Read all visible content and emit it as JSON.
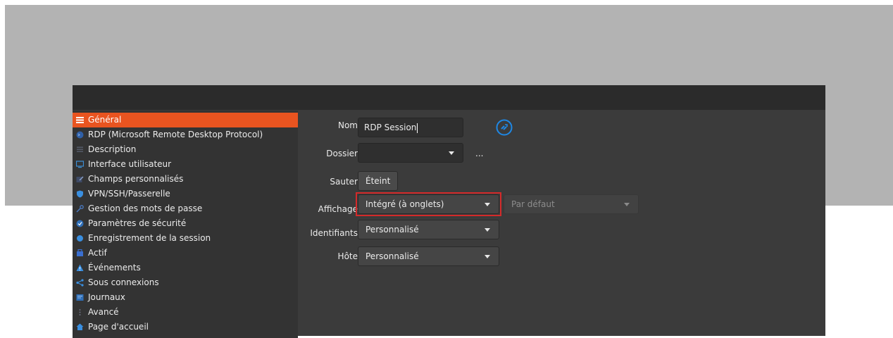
{
  "sidebar": {
    "items": [
      {
        "label": "Général",
        "icon": "list-icon",
        "color": "#ffffff",
        "active": true
      },
      {
        "label": "RDP (Microsoft Remote Desktop Protocol)",
        "icon": "rdp-icon",
        "color": "#3b6fb6"
      },
      {
        "label": "Description",
        "icon": "description-icon",
        "color": "#555a66"
      },
      {
        "label": "Interface utilisateur",
        "icon": "monitor-icon",
        "color": "#3d8fd6"
      },
      {
        "label": "Champs personnalisés",
        "icon": "edit-icon",
        "color": "#4a5a7a"
      },
      {
        "label": "VPN/SSH/Passerelle",
        "icon": "shield-icon",
        "color": "#3a8fe0"
      },
      {
        "label": "Gestion des mots de passe",
        "icon": "key-icon",
        "color": "#4a6a9a"
      },
      {
        "label": "Paramètres de sécurité",
        "icon": "security-icon",
        "color": "#3a8fe0"
      },
      {
        "label": "Enregistrement de la session",
        "icon": "record-icon",
        "color": "#3a8fe0"
      },
      {
        "label": "Actif",
        "icon": "asset-icon",
        "color": "#3a6fd0"
      },
      {
        "label": "Événements",
        "icon": "warning-icon",
        "color": "#3a8fe0"
      },
      {
        "label": "Sous connexions",
        "icon": "share-icon",
        "color": "#3a8fe0"
      },
      {
        "label": "Journaux",
        "icon": "log-icon",
        "color": "#3a7fd0"
      },
      {
        "label": "Avancé",
        "icon": "more-icon",
        "color": "#5a6070"
      },
      {
        "label": "Page d'accueil",
        "icon": "home-icon",
        "color": "#3a8fe0"
      }
    ]
  },
  "form": {
    "nom_label": "Nom",
    "nom_value": "RDP Session",
    "dossier_label": "Dossier",
    "dossier_value": "",
    "dossier_more": "...",
    "sauter_label": "Sauter",
    "sauter_value": "Éteint",
    "affichage_label": "Affichage",
    "affichage_value": "Intégré (à onglets)",
    "affichage_secondary": "Par défaut",
    "identifiants_label": "Identifiants",
    "identifiants_value": "Personnalisé",
    "hote_label": "Hôte",
    "hote_value": "Personnalisé"
  },
  "colors": {
    "accent": "#e95420",
    "highlight": "#d42a2a",
    "rdp_blue": "#1e88e5"
  }
}
